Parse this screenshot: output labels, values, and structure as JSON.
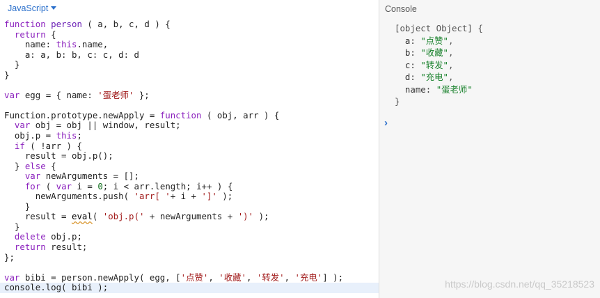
{
  "editor": {
    "language": "JavaScript",
    "lines": [
      [
        [
          "kw",
          "function "
        ],
        [
          "fn",
          "person"
        ],
        [
          "op",
          " ( a, b, c, d ) {"
        ]
      ],
      [
        [
          "op",
          "  "
        ],
        [
          "kw",
          "return"
        ],
        [
          "op",
          " {"
        ]
      ],
      [
        [
          "op",
          "    name: "
        ],
        [
          "kw",
          "this"
        ],
        [
          "op",
          ".name,"
        ]
      ],
      [
        [
          "op",
          "    a: a, b: b, c: c, d: d"
        ]
      ],
      [
        [
          "op",
          "  }"
        ]
      ],
      [
        [
          "op",
          "}"
        ]
      ],
      [
        [
          "op",
          ""
        ]
      ],
      [
        [
          "kw",
          "var"
        ],
        [
          "op",
          " egg = { name: "
        ],
        [
          "str",
          "'蛋老师'"
        ],
        [
          "op",
          " };"
        ]
      ],
      [
        [
          "op",
          ""
        ]
      ],
      [
        [
          "op",
          "Function.prototype.newApply = "
        ],
        [
          "kw",
          "function"
        ],
        [
          "op",
          " ( obj, arr ) {"
        ]
      ],
      [
        [
          "op",
          "  "
        ],
        [
          "kw",
          "var"
        ],
        [
          "op",
          " obj = obj || window, result;"
        ]
      ],
      [
        [
          "op",
          "  obj.p = "
        ],
        [
          "kw",
          "this"
        ],
        [
          "op",
          ";"
        ]
      ],
      [
        [
          "op",
          "  "
        ],
        [
          "kw",
          "if"
        ],
        [
          "op",
          " ( !arr ) {"
        ]
      ],
      [
        [
          "op",
          "    result = obj.p();"
        ]
      ],
      [
        [
          "op",
          "  } "
        ],
        [
          "kw",
          "else"
        ],
        [
          "op",
          " {"
        ]
      ],
      [
        [
          "op",
          "    "
        ],
        [
          "kw",
          "var"
        ],
        [
          "op",
          " newArguments = [];"
        ]
      ],
      [
        [
          "op",
          "    "
        ],
        [
          "kw",
          "for"
        ],
        [
          "op",
          " ( "
        ],
        [
          "kw",
          "var"
        ],
        [
          "op",
          " i = "
        ],
        [
          "num",
          "0"
        ],
        [
          "op",
          "; i < arr.length; i++ ) {"
        ]
      ],
      [
        [
          "op",
          "      newArguments.push( "
        ],
        [
          "str",
          "'arr[ '"
        ],
        [
          "op",
          "+ i + "
        ],
        [
          "str",
          "']'"
        ],
        [
          "op",
          " );"
        ]
      ],
      [
        [
          "op",
          "    }"
        ]
      ],
      [
        [
          "op",
          "    result = "
        ],
        [
          "sq",
          "eval"
        ],
        [
          "op",
          "( "
        ],
        [
          "str",
          "'obj.p('"
        ],
        [
          "op",
          " + newArguments + "
        ],
        [
          "str",
          "')'"
        ],
        [
          "op",
          " );"
        ]
      ],
      [
        [
          "op",
          "  }"
        ]
      ],
      [
        [
          "op",
          "  "
        ],
        [
          "kw",
          "delete"
        ],
        [
          "op",
          " obj.p;"
        ]
      ],
      [
        [
          "op",
          "  "
        ],
        [
          "kw",
          "return"
        ],
        [
          "op",
          " result;"
        ]
      ],
      [
        [
          "op",
          "};"
        ]
      ],
      [
        [
          "op",
          ""
        ]
      ],
      [
        [
          "kw",
          "var"
        ],
        [
          "op",
          " bibi = person.newApply( egg, ["
        ],
        [
          "str",
          "'点赞'"
        ],
        [
          "op",
          ", "
        ],
        [
          "str",
          "'收藏'"
        ],
        [
          "op",
          ", "
        ],
        [
          "str",
          "'转发'"
        ],
        [
          "op",
          ", "
        ],
        [
          "str",
          "'充电'"
        ],
        [
          "op",
          "] );"
        ]
      ],
      [
        [
          "op",
          "console.log( bibi );"
        ]
      ]
    ],
    "current_line": 26
  },
  "console": {
    "title": "Console",
    "output_lines": [
      [
        [
          "plain",
          "[object Object] {"
        ]
      ],
      [
        [
          "ckey",
          "  a: "
        ],
        [
          "cstr",
          "\"点赞\""
        ],
        [
          "plain",
          ","
        ]
      ],
      [
        [
          "ckey",
          "  b: "
        ],
        [
          "cstr",
          "\"收藏\""
        ],
        [
          "plain",
          ","
        ]
      ],
      [
        [
          "ckey",
          "  c: "
        ],
        [
          "cstr",
          "\"转发\""
        ],
        [
          "plain",
          ","
        ]
      ],
      [
        [
          "ckey",
          "  d: "
        ],
        [
          "cstr",
          "\"充电\""
        ],
        [
          "plain",
          ","
        ]
      ],
      [
        [
          "ckey",
          "  name: "
        ],
        [
          "cstr",
          "\"蛋老师\""
        ]
      ],
      [
        [
          "plain",
          "}"
        ]
      ]
    ],
    "prompt_glyph": "›"
  },
  "watermark": "https://blog.csdn.net/qq_35218523"
}
